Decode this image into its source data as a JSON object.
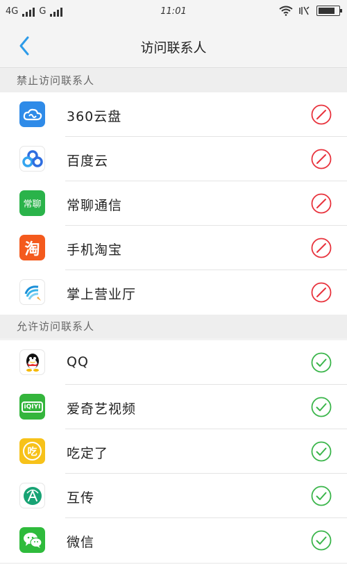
{
  "status_bar": {
    "network1": "4G",
    "network2": "G",
    "time": "11:01",
    "battery_percent": 85,
    "icons": [
      "signal-icon",
      "wifi-icon",
      "vibrate-icon",
      "battery-icon"
    ]
  },
  "nav": {
    "title": "访问联系人",
    "back_icon": "chevron-left-icon"
  },
  "sections": {
    "denied": {
      "header": "禁止访问联系人",
      "status_icon": "deny-circle-icon",
      "status_color": "#e8323c",
      "apps": [
        {
          "name": "360云盘",
          "icon": "cloud-icon",
          "color": "#2f8be8"
        },
        {
          "name": "百度云",
          "icon": "baidu-cloud-icon",
          "color": "#ffffff"
        },
        {
          "name": "常聊通信",
          "icon": "changliao-icon",
          "color": "#2ab34a",
          "icon_text": "常聊"
        },
        {
          "name": "手机淘宝",
          "icon": "taobao-icon",
          "color": "#f45a1d",
          "icon_text": "淘"
        },
        {
          "name": "掌上营业厅",
          "icon": "china-mobile-icon",
          "color": "#ffffff"
        }
      ]
    },
    "allowed": {
      "header": "允许访问联系人",
      "status_icon": "check-circle-icon",
      "status_color": "#3ab54a",
      "apps": [
        {
          "name": "QQ",
          "icon": "qq-penguin-icon",
          "color": "#ffffff"
        },
        {
          "name": "爱奇艺视频",
          "icon": "iqiyi-icon",
          "color": "#34b53c",
          "icon_text": "iQIYI"
        },
        {
          "name": "吃定了",
          "icon": "chidingle-icon",
          "color": "#f7c21a",
          "icon_text": "吃"
        },
        {
          "name": "互传",
          "icon": "transfer-icon",
          "color": "#ffffff"
        },
        {
          "name": "微信",
          "icon": "wechat-icon",
          "color": "#2fbb3c"
        }
      ]
    }
  }
}
